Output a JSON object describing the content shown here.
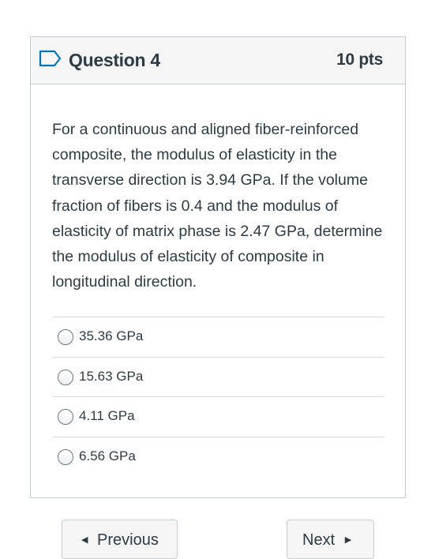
{
  "question": {
    "title": "Question 4",
    "points": "10 pts",
    "text": "For a continuous and aligned fiber-reinforced composite, the modulus of elasticity in the transverse direction is 3.94 GPa. If the volume fraction of fibers is 0.4 and the modulus of elasticity of matrix phase is 2.47 GPa, determine the modulus of elasticity of composite in longitudinal direction.",
    "answers": [
      {
        "label": "35.36 GPa"
      },
      {
        "label": "15.63 GPa"
      },
      {
        "label": "4.11 GPa"
      },
      {
        "label": "6.56 GPa"
      }
    ]
  },
  "navigation": {
    "previous_label": "Previous",
    "next_label": "Next"
  },
  "icons": {
    "flag": "bookmark-flag-icon",
    "radio": "radio-unselected-icon",
    "prev_caret": "caret-left-icon",
    "next_caret": "caret-right-icon"
  },
  "colors": {
    "accent": "#0374b5",
    "text": "#2d3b45",
    "border": "#c7cdd1",
    "header_bg": "#f5f5f5"
  }
}
